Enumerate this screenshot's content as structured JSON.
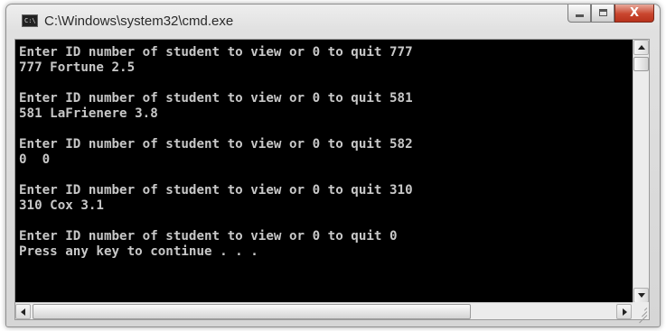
{
  "window": {
    "title": "C:\\Windows\\system32\\cmd.exe",
    "icon": "cmd-icon",
    "icon_text": "C:\\"
  },
  "caption_buttons": {
    "minimize": "minimize-icon",
    "maximize": "maximize-icon",
    "close_glyph": "X"
  },
  "console": {
    "lines": [
      "Enter ID number of student to view or 0 to quit 777",
      "777 Fortune 2.5",
      "",
      "Enter ID number of student to view or 0 to quit 581",
      "581 LaFrienere 3.8",
      "",
      "Enter ID number of student to view or 0 to quit 582",
      "0  0",
      "",
      "Enter ID number of student to view or 0 to quit 310",
      "310 Cox 3.1",
      "",
      "Enter ID number of student to view or 0 to quit 0",
      "Press any key to continue . . ."
    ],
    "text_color": "#c8c8c8",
    "background": "#000000"
  }
}
